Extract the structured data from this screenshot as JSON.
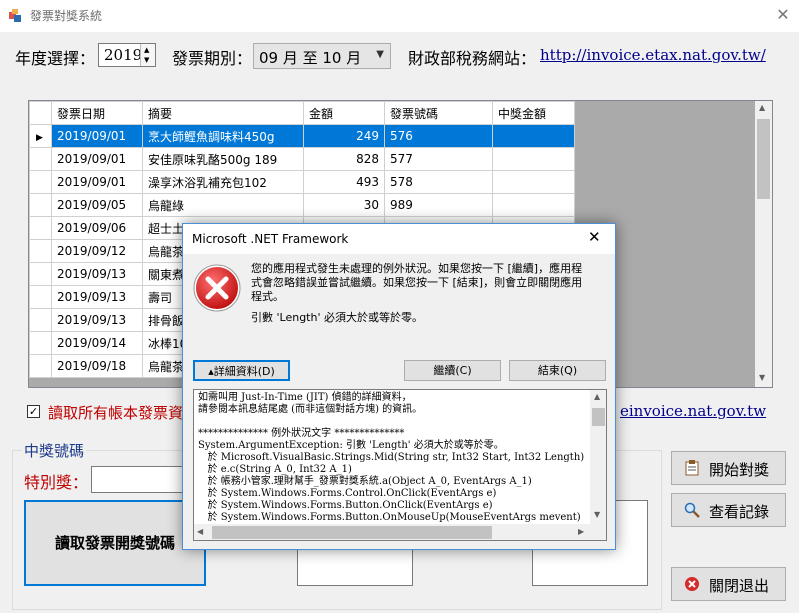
{
  "window": {
    "title": "發票對獎系統",
    "close_glyph": "✕"
  },
  "header": {
    "year_label": "年度選擇：",
    "year_value": "2019",
    "period_label": "發票期別：",
    "period_value": "09 月 至 10 月",
    "mof_label": "財政部稅務網站：",
    "mof_link": "http://invoice.etax.nat.gov.tw/"
  },
  "grid": {
    "columns": [
      "發票日期",
      "摘要",
      "金額",
      "發票號碼",
      "中獎金額"
    ],
    "rows": [
      {
        "date": "2019/09/01",
        "item": "烹大師鰹魚調味料450g",
        "amount": "249",
        "number": "576",
        "prize": ""
      },
      {
        "date": "2019/09/01",
        "item": "安佳原味乳酪500g 189",
        "amount": "828",
        "number": "577",
        "prize": ""
      },
      {
        "date": "2019/09/01",
        "item": "澡享沐浴乳補充包102",
        "amount": "493",
        "number": "578",
        "prize": ""
      },
      {
        "date": "2019/09/05",
        "item": "烏龍綠",
        "amount": "30",
        "number": "989",
        "prize": ""
      },
      {
        "date": "2019/09/06",
        "item": "超士土",
        "amount": "",
        "number": "",
        "prize": ""
      },
      {
        "date": "2019/09/12",
        "item": "烏龍茶",
        "amount": "",
        "number": "",
        "prize": ""
      },
      {
        "date": "2019/09/13",
        "item": "關東煮",
        "amount": "",
        "number": "",
        "prize": ""
      },
      {
        "date": "2019/09/13",
        "item": "壽司",
        "amount": "",
        "number": "",
        "prize": ""
      },
      {
        "date": "2019/09/13",
        "item": "排骨飯",
        "amount": "",
        "number": "",
        "prize": ""
      },
      {
        "date": "2019/09/14",
        "item": "冰棒10",
        "amount": "",
        "number": "",
        "prize": ""
      },
      {
        "date": "2019/09/18",
        "item": "烏龍茶",
        "amount": "",
        "number": "",
        "prize": ""
      }
    ],
    "row_marker": "▶"
  },
  "options": {
    "check_mark": "✓",
    "read_all_label": "讀取所有帳本發票資",
    "einvoice_link": "einvoice.nat.gov.tw"
  },
  "prize": {
    "group_title": "中獎號碼",
    "special_label": "特別獎：",
    "read_button": "讀取發票開獎號碼"
  },
  "actions": {
    "start_label": "開始對獎",
    "history_label": "查看記錄",
    "exit_label": "關閉退出"
  },
  "dialog": {
    "title": "Microsoft .NET Framework",
    "close_glyph": "✕",
    "message": "您的應用程式發生未處理的例外狀況。如果您按一下 [繼續]，應用程式會忽略錯誤並嘗試繼續。如果您按一下 [結束]，則會立即關閉應用程式。",
    "error": "引數 'Length' 必須大於或等於零。",
    "details_button": "▴詳細資料(D)",
    "continue_button": "繼續(C)",
    "quit_button": "結束(Q)",
    "details_text": "如需叫用 Just-In-Time (JIT) 偵錯的詳細資料，\n請參閱本訊息結尾處 (而非這個對話方塊) 的資訊。\n\n************** 例外狀況文字 **************\nSystem.ArgumentException: 引數 'Length' 必須大於或等於零。\n   於 Microsoft.VisualBasic.Strings.Mid(String str, Int32 Start, Int32 Length)\n   於 e.c(String A_0, Int32 A_1)\n   於 帳務小管家.理財幫手_發票對獎系統.a(Object A_0, EventArgs A_1)\n   於 System.Windows.Forms.Control.OnClick(EventArgs e)\n   於 System.Windows.Forms.Button.OnClick(EventArgs e)\n   於 System.Windows.Forms.Button.OnMouseUp(MouseEventArgs mevent)"
  }
}
